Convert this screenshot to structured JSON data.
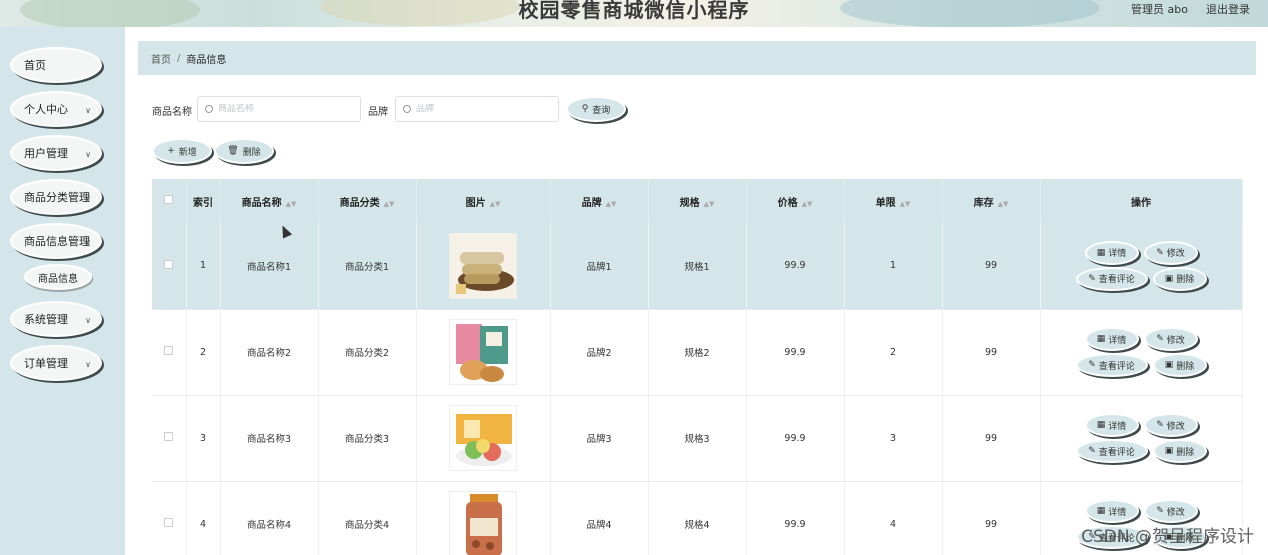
{
  "header": {
    "title": "校园零售商城微信小程序",
    "user": "管理员 abo",
    "logout": "退出登录"
  },
  "sidebar": {
    "items": [
      {
        "label": "首页",
        "has_arrow": false
      },
      {
        "label": "个人中心",
        "has_arrow": true
      },
      {
        "label": "用户管理",
        "has_arrow": true
      },
      {
        "label": "商品分类管理",
        "has_arrow": true
      },
      {
        "label": "商品信息管理",
        "has_arrow": true
      },
      {
        "label": "系统管理",
        "has_arrow": true
      },
      {
        "label": "订单管理",
        "has_arrow": true
      }
    ],
    "sub_item": "商品信息"
  },
  "breadcrumb": {
    "home": "首页",
    "sep": "/",
    "current": "商品信息"
  },
  "search": {
    "name_label": "商品名称",
    "name_placeholder": "商品名称",
    "brand_label": "品牌",
    "brand_placeholder": "品牌",
    "query_button": "查询"
  },
  "toolbar": {
    "add_button": "新增",
    "delete_button": "删除"
  },
  "table": {
    "headers": [
      "索引",
      "商品名称",
      "商品分类",
      "图片",
      "品牌",
      "规格",
      "价格",
      "单限",
      "库存",
      "操作"
    ],
    "rows": [
      {
        "index": "1",
        "name": "商品名称1",
        "category": "商品分类1",
        "brand": "品牌1",
        "spec": "规格1",
        "price": "99.9",
        "limit": "1",
        "stock": "99"
      },
      {
        "index": "2",
        "name": "商品名称2",
        "category": "商品分类2",
        "brand": "品牌2",
        "spec": "规格2",
        "price": "99.9",
        "limit": "2",
        "stock": "99"
      },
      {
        "index": "3",
        "name": "商品名称3",
        "category": "商品分类3",
        "brand": "品牌3",
        "spec": "规格3",
        "price": "99.9",
        "limit": "3",
        "stock": "99"
      },
      {
        "index": "4",
        "name": "商品名称4",
        "category": "商品分类4",
        "brand": "品牌4",
        "spec": "规格4",
        "price": "99.9",
        "limit": "4",
        "stock": "99"
      }
    ],
    "actions": {
      "detail": "详情",
      "edit": "修改",
      "comments": "查看评论",
      "delete": "删除"
    }
  },
  "watermark": "CSDN @贺呈程序设计",
  "colors": {
    "accent": "#d4e6e9",
    "shadow": "#3f4a4c"
  }
}
